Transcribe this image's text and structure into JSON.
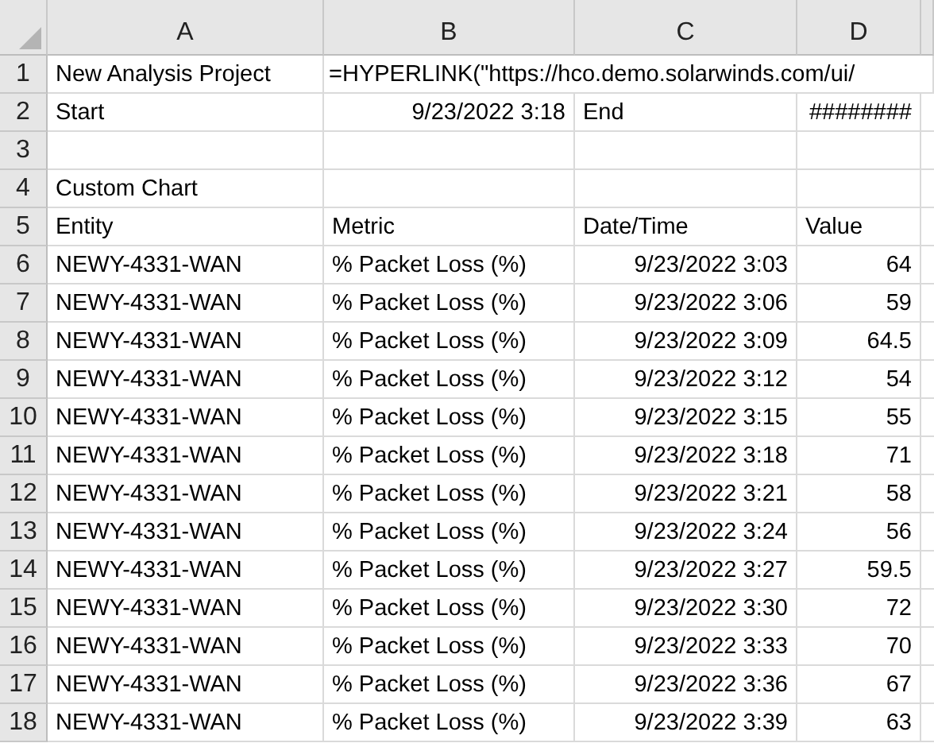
{
  "columns": [
    "A",
    "B",
    "C",
    "D"
  ],
  "rows": [
    {
      "number": "1",
      "cells": [
        {
          "kind": "text",
          "text": "New Analysis Project"
        },
        {
          "kind": "overflow",
          "text": "=HYPERLINK(\"https://hco.demo.solarwinds.com/ui/"
        }
      ]
    },
    {
      "number": "2",
      "cells": [
        {
          "kind": "text",
          "text": "Start"
        },
        {
          "kind": "number",
          "text": "9/23/2022 3:18"
        },
        {
          "kind": "text",
          "text": "End"
        },
        {
          "kind": "number",
          "text": "########"
        }
      ]
    },
    {
      "number": "3",
      "cells": []
    },
    {
      "number": "4",
      "cells": [
        {
          "kind": "text",
          "text": "Custom Chart"
        }
      ]
    },
    {
      "number": "5",
      "cells": [
        {
          "kind": "text",
          "text": "Entity"
        },
        {
          "kind": "text",
          "text": "Metric"
        },
        {
          "kind": "text",
          "text": "Date/Time"
        },
        {
          "kind": "text",
          "text": "Value"
        }
      ]
    },
    {
      "number": "6",
      "cells": [
        {
          "kind": "text",
          "text": "NEWY-4331-WAN"
        },
        {
          "kind": "text",
          "text": "% Packet Loss (%)"
        },
        {
          "kind": "number",
          "text": "9/23/2022 3:03"
        },
        {
          "kind": "number",
          "text": "64"
        }
      ]
    },
    {
      "number": "7",
      "cells": [
        {
          "kind": "text",
          "text": "NEWY-4331-WAN"
        },
        {
          "kind": "text",
          "text": "% Packet Loss (%)"
        },
        {
          "kind": "number",
          "text": "9/23/2022 3:06"
        },
        {
          "kind": "number",
          "text": "59"
        }
      ]
    },
    {
      "number": "8",
      "cells": [
        {
          "kind": "text",
          "text": "NEWY-4331-WAN"
        },
        {
          "kind": "text",
          "text": "% Packet Loss (%)"
        },
        {
          "kind": "number",
          "text": "9/23/2022 3:09"
        },
        {
          "kind": "number",
          "text": "64.5"
        }
      ]
    },
    {
      "number": "9",
      "cells": [
        {
          "kind": "text",
          "text": "NEWY-4331-WAN"
        },
        {
          "kind": "text",
          "text": "% Packet Loss (%)"
        },
        {
          "kind": "number",
          "text": "9/23/2022 3:12"
        },
        {
          "kind": "number",
          "text": "54"
        }
      ]
    },
    {
      "number": "10",
      "cells": [
        {
          "kind": "text",
          "text": "NEWY-4331-WAN"
        },
        {
          "kind": "text",
          "text": "% Packet Loss (%)"
        },
        {
          "kind": "number",
          "text": "9/23/2022 3:15"
        },
        {
          "kind": "number",
          "text": "55"
        }
      ]
    },
    {
      "number": "11",
      "cells": [
        {
          "kind": "text",
          "text": "NEWY-4331-WAN"
        },
        {
          "kind": "text",
          "text": "% Packet Loss (%)"
        },
        {
          "kind": "number",
          "text": "9/23/2022 3:18"
        },
        {
          "kind": "number",
          "text": "71"
        }
      ]
    },
    {
      "number": "12",
      "cells": [
        {
          "kind": "text",
          "text": "NEWY-4331-WAN"
        },
        {
          "kind": "text",
          "text": "% Packet Loss (%)"
        },
        {
          "kind": "number",
          "text": "9/23/2022 3:21"
        },
        {
          "kind": "number",
          "text": "58"
        }
      ]
    },
    {
      "number": "13",
      "cells": [
        {
          "kind": "text",
          "text": "NEWY-4331-WAN"
        },
        {
          "kind": "text",
          "text": "% Packet Loss (%)"
        },
        {
          "kind": "number",
          "text": "9/23/2022 3:24"
        },
        {
          "kind": "number",
          "text": "56"
        }
      ]
    },
    {
      "number": "14",
      "cells": [
        {
          "kind": "text",
          "text": "NEWY-4331-WAN"
        },
        {
          "kind": "text",
          "text": "% Packet Loss (%)"
        },
        {
          "kind": "number",
          "text": "9/23/2022 3:27"
        },
        {
          "kind": "number",
          "text": "59.5"
        }
      ]
    },
    {
      "number": "15",
      "cells": [
        {
          "kind": "text",
          "text": "NEWY-4331-WAN"
        },
        {
          "kind": "text",
          "text": "% Packet Loss (%)"
        },
        {
          "kind": "number",
          "text": "9/23/2022 3:30"
        },
        {
          "kind": "number",
          "text": "72"
        }
      ]
    },
    {
      "number": "16",
      "cells": [
        {
          "kind": "text",
          "text": "NEWY-4331-WAN"
        },
        {
          "kind": "text",
          "text": "% Packet Loss (%)"
        },
        {
          "kind": "number",
          "text": "9/23/2022 3:33"
        },
        {
          "kind": "number",
          "text": "70"
        }
      ]
    },
    {
      "number": "17",
      "cells": [
        {
          "kind": "text",
          "text": "NEWY-4331-WAN"
        },
        {
          "kind": "text",
          "text": "% Packet Loss (%)"
        },
        {
          "kind": "number",
          "text": "9/23/2022 3:36"
        },
        {
          "kind": "number",
          "text": "67"
        }
      ]
    },
    {
      "number": "18",
      "cells": [
        {
          "kind": "text",
          "text": "NEWY-4331-WAN"
        },
        {
          "kind": "text",
          "text": "% Packet Loss (%)"
        },
        {
          "kind": "number",
          "text": "9/23/2022 3:39"
        },
        {
          "kind": "number",
          "text": "63"
        }
      ]
    }
  ]
}
